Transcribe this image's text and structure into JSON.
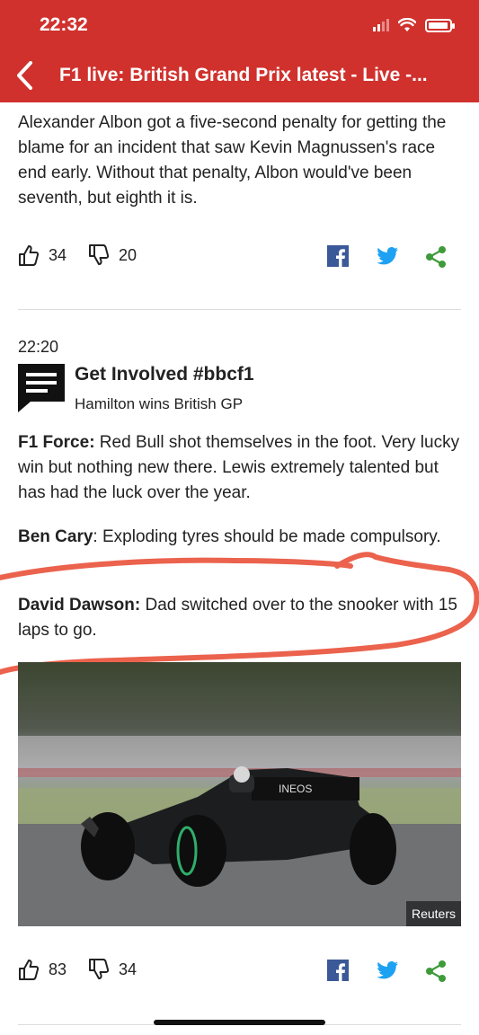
{
  "status_bar": {
    "time": "22:32"
  },
  "header": {
    "title": "F1 live: British Grand Prix latest - Live -..."
  },
  "entry1": {
    "text": "Alexander Albon got a five-second penalty for getting the blame for an incident that saw Kevin Magnussen's race end early. Without that penalty, Albon would've been seventh, but eighth it is.",
    "likes": "34",
    "dislikes": "20"
  },
  "entry2": {
    "time": "22:20",
    "title": "Get Involved #bbcf1",
    "subtitle": "Hamilton wins British GP",
    "comments": [
      {
        "author": "F1 Force:",
        "text": " Red Bull shot themselves in the foot. Very lucky win but nothing new there. Lewis extremely talented but has had the luck over the year."
      },
      {
        "author": "Ben Cary",
        "text": ": Exploding tyres should be made compulsory."
      },
      {
        "author": "David Dawson:",
        "text": " Dad switched over to the snooker with 15 laps to go."
      }
    ],
    "photo_credit": "Reuters",
    "car_sponsor": "INEOS",
    "likes": "83",
    "dislikes": "34"
  },
  "colors": {
    "header_bg": "#d0312d",
    "facebook": "#3b5998",
    "twitter": "#1da1f2",
    "share": "#3f9b3a",
    "annotation": "#e8472e"
  },
  "icons": [
    "back-chevron-icon",
    "thumbs-up-icon",
    "thumbs-down-icon",
    "facebook-icon",
    "twitter-icon",
    "share-icon",
    "speech-bubble-icon",
    "signal-icon",
    "wifi-icon",
    "battery-icon"
  ]
}
